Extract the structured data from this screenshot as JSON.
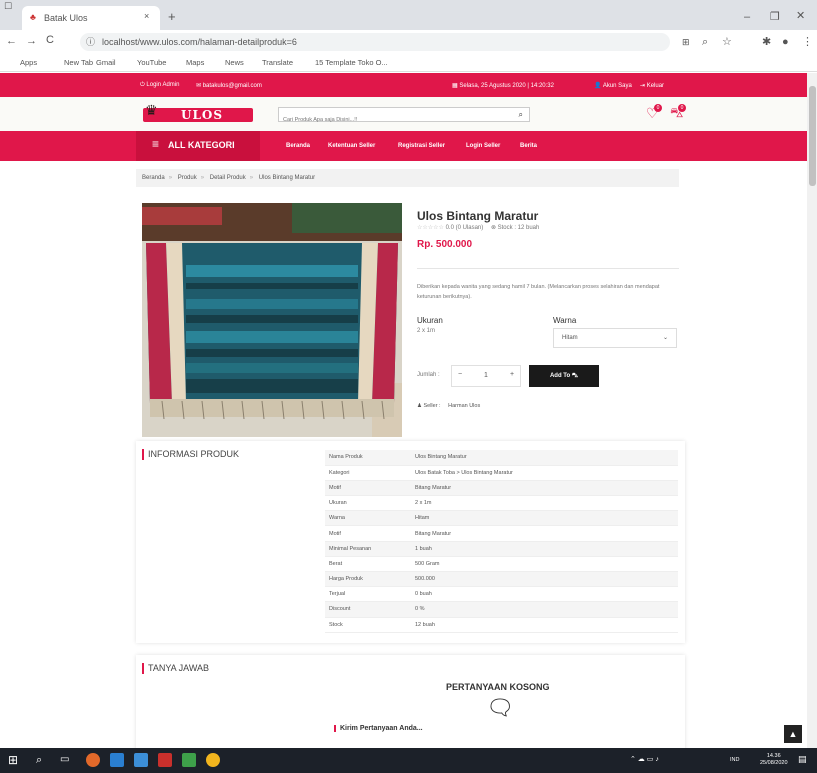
{
  "browser": {
    "tab_title": "Batak Ulos",
    "new_tab": "+",
    "url": "localhost/www.ulos.com/halaman-detailproduk=6",
    "bookmarks": [
      "Apps",
      "New Tab",
      "Gmail",
      "YouTube",
      "Maps",
      "News",
      "Translate",
      "15 Template Toko O..."
    ]
  },
  "topbar": {
    "login_admin": "Login Admin",
    "email": "batakulos@gmail.com",
    "datetime": "Selasa, 25 Agustus 2020 | 14:20:32",
    "account": "Akun Saya",
    "logout": "Keluar"
  },
  "search": {
    "placeholder": "Cari Produk Apa saja Disini...!!"
  },
  "logo_text": "ULOS",
  "cart": {
    "wishlist_count": "0",
    "cart_count": "0"
  },
  "nav": {
    "all_categories": "ALL KATEGORI",
    "items": [
      "Beranda",
      "Ketentuan Seller",
      "Registrasi Seller",
      "Login Seller",
      "Berita"
    ]
  },
  "breadcrumb": [
    "Beranda",
    "Produk",
    "Detail Produk",
    "Ulos Bintang Maratur"
  ],
  "product": {
    "title": "Ulos Bintang Maratur",
    "rating": "0.0",
    "reviews": "(0 Ulasan)",
    "stock_label": "Stock : 12 buah",
    "price": "Rp. 500.000",
    "description": "Diberikan kepada wanita yang sedang hamil 7 bulan. (Melancarkan proses selahiran dan mendapat keturunan berikutnya).",
    "size_label": "Ukuran",
    "size_value": "2 x 1m",
    "color_label": "Warna",
    "color_value": "Hitam",
    "qty_label": "Jumlah :",
    "qty_value": "1",
    "add_to_cart": "Add To",
    "seller_label": "Seller :",
    "seller_name": "Harman Ulos"
  },
  "info": {
    "title": "INFORMASI PRODUK",
    "rows": [
      [
        "Nama Produk",
        "Ulos Bintang Maratur"
      ],
      [
        "Kategori",
        "Ulos Batak Toba > Ulos Bintang Maratur"
      ],
      [
        "Motif",
        "Bitang Maratur"
      ],
      [
        "Ukuran",
        "2 x 1m"
      ],
      [
        "Warna",
        "Hitam"
      ],
      [
        "Motif",
        "Bitang Maratur"
      ],
      [
        "Minimal Pesanan",
        "1 buah"
      ],
      [
        "Berat",
        "500 Gram"
      ],
      [
        "Harga Produk",
        "500.000"
      ],
      [
        "Terjual",
        "0 buah"
      ],
      [
        "Discount",
        "0 %"
      ],
      [
        "Stock",
        "12 buah"
      ]
    ]
  },
  "qa": {
    "title": "TANYA JAWAB",
    "empty": "PERTANYAAN KOSONG",
    "ask": "Kirim Pertanyaan Anda..."
  },
  "taskbar": {
    "time": "14.36",
    "date": "25/08/2020",
    "lang": "IND"
  },
  "colors": {
    "accent": "#e0174a",
    "dark": "#1a1a1a"
  }
}
